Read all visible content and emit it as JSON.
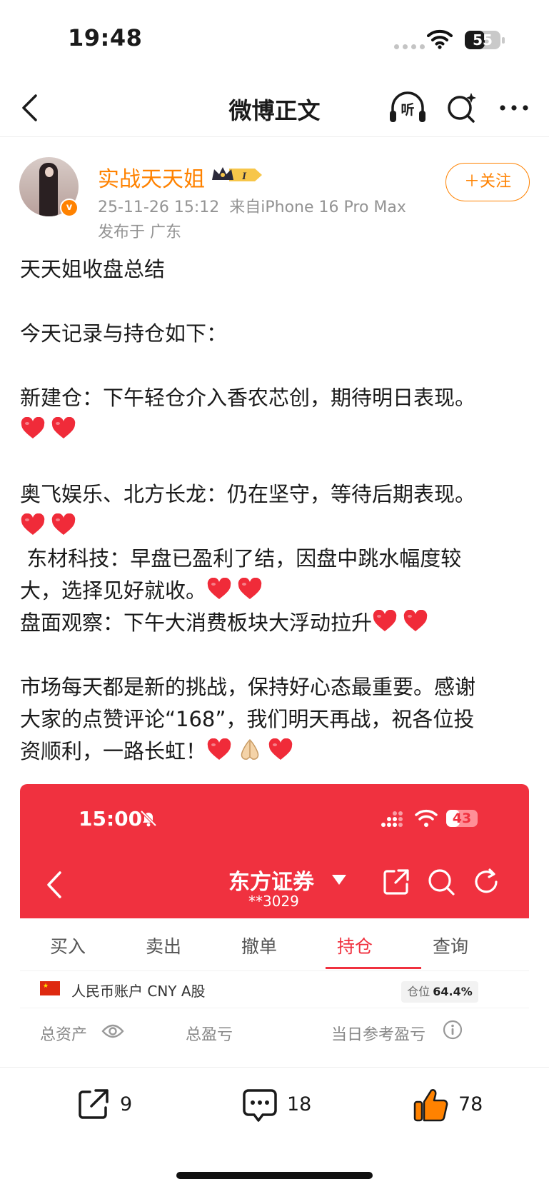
{
  "status_bar": {
    "time": "19:48",
    "battery": "55",
    "battery_level": 0.55
  },
  "nav": {
    "title": "微博正文",
    "listen_label": "听"
  },
  "author": {
    "name": "实战天天姐",
    "level_badge": "I",
    "post_time": "25-11-26 15:12",
    "source": "来自iPhone 16 Pro Max",
    "location": "发布于 广东",
    "follow_label": "＋关注"
  },
  "post": {
    "title_line": "天天姐收盘总结",
    "line1": "今天记录与持仓如下：",
    "line2": "新建仓：下午轻仓介入香农芯创，期待明日表现。",
    "line3": "奥飞娱乐、北方长龙：仍在坚守，等待后期表现。",
    "line4a": " 东材科技：早盘已盈利了结，因盘中跳水幅度较",
    "line4b": "大，选择见好就收。",
    "line5": "盘面观察：下午大消费板块大浮动拉升",
    "line6a": "市场每天都是新的挑战，保持好心态最重要。感谢",
    "line6b": "大家的点赞评论“168”，我们明天再战，祝各位投",
    "line6c": "资顺利，一路长虹！"
  },
  "embedded_screenshot": {
    "time": "15:00",
    "battery": "43",
    "battery_level": 0.43,
    "title": "东方证券",
    "account": "**3029",
    "tabs": [
      "买入",
      "卖出",
      "撤单",
      "持仓",
      "查询"
    ],
    "active_tab": "持仓",
    "account_type": "人民币账户 CNY A股",
    "position_label": "仓位",
    "position_value": "64.4%",
    "total_assets_label": "总资产",
    "total_pnl_label": "总盈亏",
    "daily_pnl_label": "当日参考盈亏"
  },
  "actions": {
    "share_count": "9",
    "comment_count": "18",
    "like_count": "78"
  },
  "colors": {
    "brand_orange": "#ff8200",
    "broker_red": "#f0313f",
    "heart_red": "#f02b39"
  },
  "icons": [
    "back-icon",
    "headphones-icon",
    "search-icon",
    "more-icon",
    "verified-icon",
    "crown-icon",
    "heart-icon",
    "folded-hands-icon",
    "share-icon",
    "comment-icon",
    "like-icon"
  ]
}
